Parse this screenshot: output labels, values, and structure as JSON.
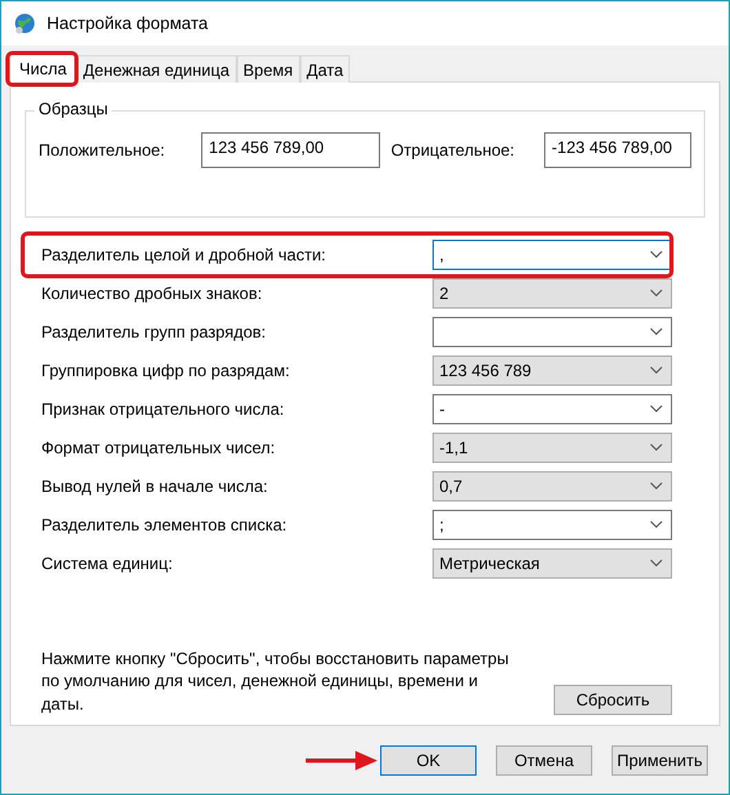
{
  "window": {
    "title": "Настройка формата"
  },
  "tabs": [
    {
      "label": "Числа",
      "selected": true,
      "highlighted": true
    },
    {
      "label": "Денежная единица",
      "selected": false,
      "highlighted": false
    },
    {
      "label": "Время",
      "selected": false,
      "highlighted": false
    },
    {
      "label": "Дата",
      "selected": false,
      "highlighted": false
    }
  ],
  "samples": {
    "title": "Образцы",
    "items": [
      {
        "label": "Положительное:",
        "value": "123 456 789,00"
      },
      {
        "label": "Отрицательное:",
        "value": "-123 456 789,00"
      }
    ]
  },
  "settings": [
    {
      "label": "Разделитель целой и дробной части:",
      "value": ",",
      "kind": "editable",
      "focused": true,
      "highlighted": true
    },
    {
      "label": "Количество дробных знаков:",
      "value": "2",
      "kind": "list",
      "focused": false,
      "highlighted": false
    },
    {
      "label": "Разделитель групп разрядов:",
      "kind": "editable",
      "focused": false,
      "highlighted": false
    },
    {
      "label": "Группировка цифр по разрядам:",
      "value": "123 456 789",
      "kind": "list",
      "focused": false,
      "highlighted": false
    },
    {
      "label": "Признак отрицательного числа:",
      "value": "-",
      "kind": "editable",
      "focused": false,
      "highlighted": false
    },
    {
      "label": "Формат отрицательных чисел:",
      "value": "-1,1",
      "kind": "list",
      "focused": false,
      "highlighted": false
    },
    {
      "label": "Вывод нулей в начале числа:",
      "value": "0,7",
      "kind": "list",
      "focused": false,
      "highlighted": false
    },
    {
      "label": "Разделитель элементов списка:",
      "value": ";",
      "kind": "editable",
      "focused": false,
      "highlighted": false
    },
    {
      "label": "Система единиц:",
      "value": "Метрическая",
      "kind": "list",
      "focused": false,
      "highlighted": false
    }
  ],
  "reset": {
    "text": "Нажмите кнопку \"Сбросить\", чтобы восстановить параметры по умолчанию для чисел, денежной единицы, времени и даты.",
    "button": "Сбросить"
  },
  "buttons": [
    {
      "label": "OK",
      "default": true,
      "pointed": true
    },
    {
      "label": "Отмена",
      "default": false,
      "pointed": false
    },
    {
      "label": "Применить",
      "default": false,
      "pointed": false
    }
  ]
}
